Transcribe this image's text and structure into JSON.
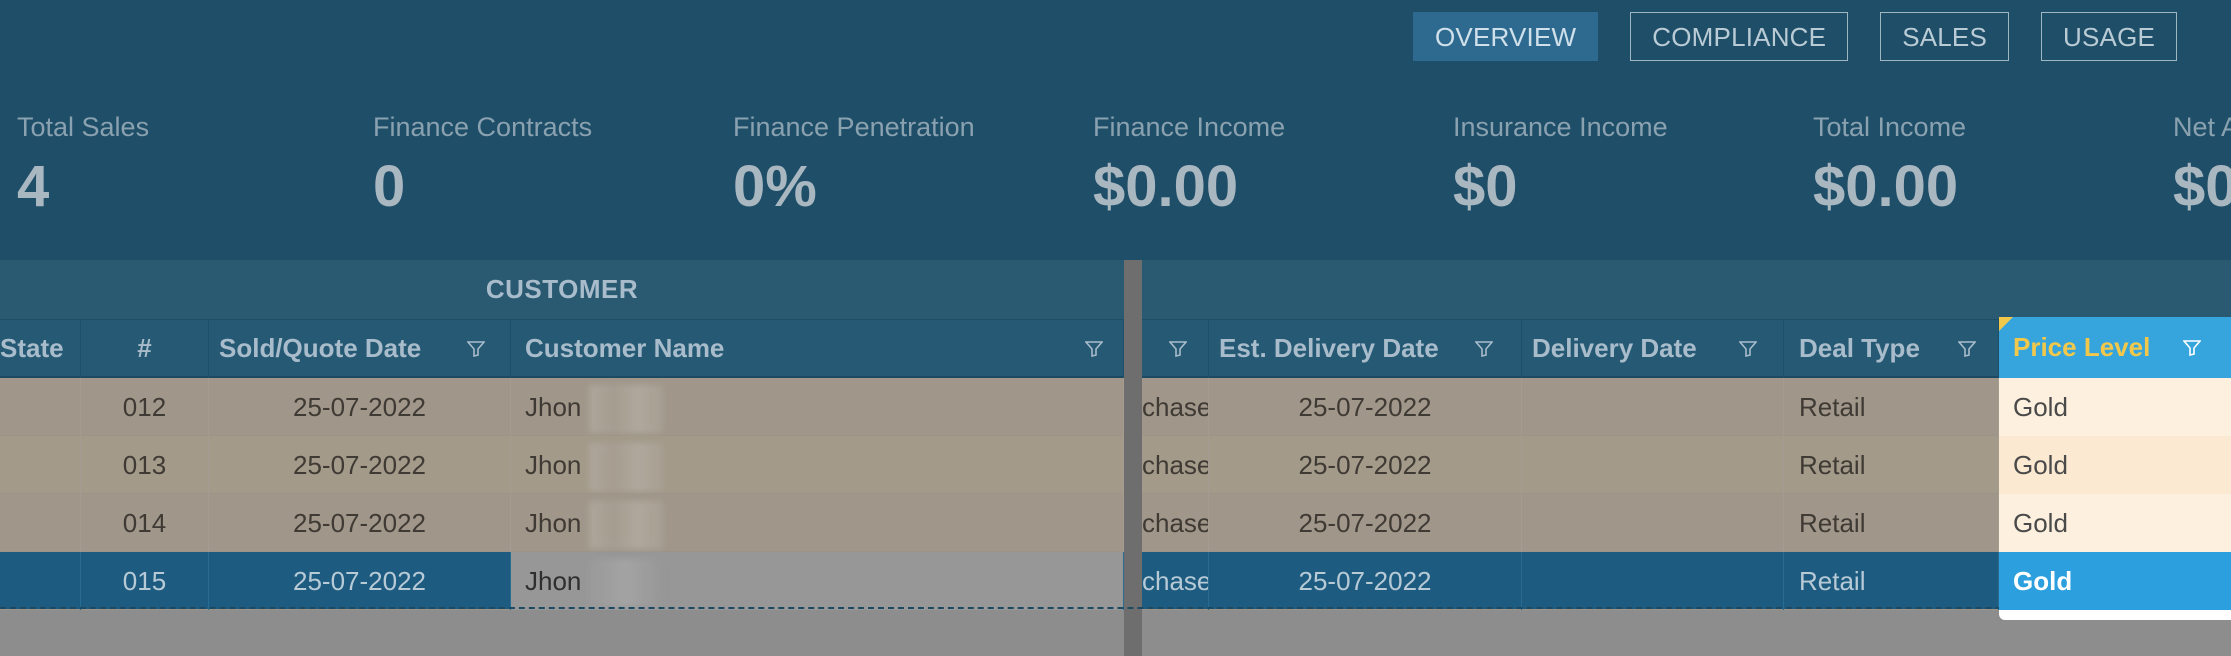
{
  "nav": {
    "tabs": [
      {
        "label": "OVERVIEW",
        "active": true
      },
      {
        "label": "COMPLIANCE",
        "active": false
      },
      {
        "label": "SALES",
        "active": false
      },
      {
        "label": "USAGE",
        "active": false
      }
    ]
  },
  "kpis": [
    {
      "label": "Total Sales",
      "value": "4"
    },
    {
      "label": "Finance Contracts",
      "value": "0"
    },
    {
      "label": "Finance Penetration",
      "value": "0%"
    },
    {
      "label": "Finance Income",
      "value": "$0.00"
    },
    {
      "label": "Insurance Income",
      "value": "$0"
    },
    {
      "label": "Total Income",
      "value": "$0.00"
    },
    {
      "label": "Net A",
      "value": "$0"
    }
  ],
  "grid": {
    "group_label": "CUSTOMER",
    "left_columns": [
      "State",
      "#",
      "Sold/Quote Date",
      "Customer Name"
    ],
    "right_columns": [
      "",
      "Est. Delivery Date",
      "Delivery Date",
      "Deal Type",
      "Price Level"
    ],
    "rows": [
      {
        "num": "012",
        "sold_date": "25-07-2022",
        "customer": "Jhon",
        "purchase": "chase",
        "est_delivery": "25-07-2022",
        "delivery": "",
        "deal_type": "Retail",
        "price_level": "Gold"
      },
      {
        "num": "013",
        "sold_date": "25-07-2022",
        "customer": "Jhon",
        "purchase": "chase",
        "est_delivery": "25-07-2022",
        "delivery": "",
        "deal_type": "Retail",
        "price_level": "Gold"
      },
      {
        "num": "014",
        "sold_date": "25-07-2022",
        "customer": "Jhon",
        "purchase": "chase",
        "est_delivery": "25-07-2022",
        "delivery": "",
        "deal_type": "Retail",
        "price_level": "Gold"
      },
      {
        "num": "015",
        "sold_date": "25-07-2022",
        "customer": "Jhon",
        "purchase": "chase",
        "est_delivery": "25-07-2022",
        "delivery": "",
        "deal_type": "Retail",
        "price_level": "Gold"
      }
    ],
    "selected_row_index": 3
  },
  "colors": {
    "band": "#1f4e68",
    "header": "#265a74",
    "selected_row": "#1d5c80",
    "price_level_accent": "#36a4dd",
    "price_level_label": "#f1c84a"
  }
}
